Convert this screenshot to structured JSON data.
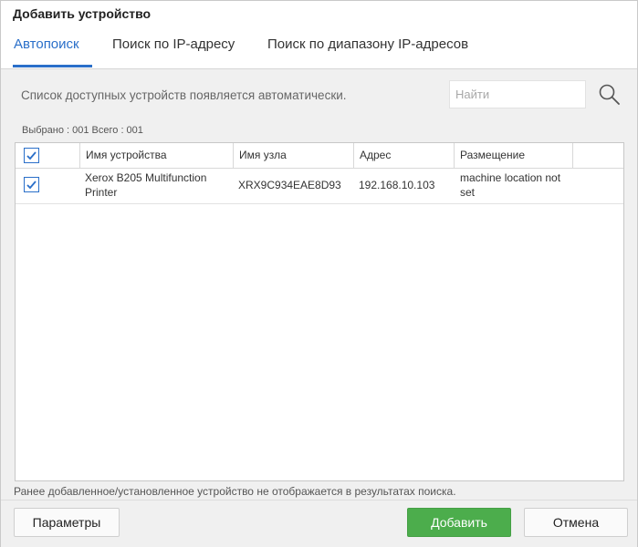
{
  "window": {
    "title": "Добавить устройство"
  },
  "tabs": [
    {
      "label": "Автопоиск",
      "active": true
    },
    {
      "label": "Поиск по IP-адресу",
      "active": false
    },
    {
      "label": "Поиск по диапазону IP-адресов",
      "active": false
    }
  ],
  "info_text": "Список доступных устройств появляется автоматически.",
  "search": {
    "placeholder": "Найти",
    "value": ""
  },
  "counts": {
    "text": "Выбрано : 001  Всего : 001"
  },
  "table": {
    "columns": [
      "Имя устройства",
      "Имя узла",
      "Адрес",
      "Размещение"
    ],
    "rows": [
      {
        "checked": true,
        "device_name_line1": "Xerox B205 Multifunction",
        "device_name_line2": "Printer",
        "host_name": "XRX9C934EAE8D93",
        "address": "192.168.10.103",
        "location_line1": "machine location not",
        "location_line2": "set"
      }
    ]
  },
  "footnote": "Ранее добавленное/установленное устройство не отображается в результатах поиска.",
  "buttons": {
    "parameters": "Параметры",
    "add": "Добавить",
    "cancel": "Отмена"
  },
  "colors": {
    "accent": "#2a6fc9",
    "primary_button": "#4cad4c"
  }
}
